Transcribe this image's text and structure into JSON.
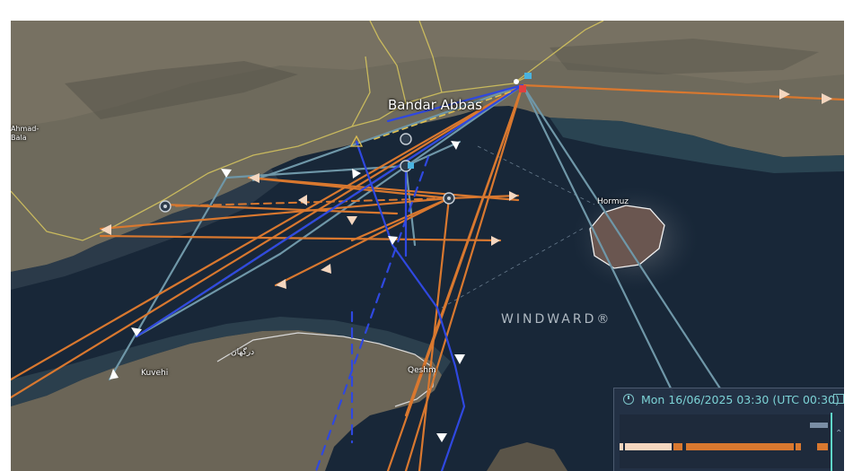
{
  "map": {
    "places": {
      "bandar_abbas": "Bandar Abbas",
      "hormuz": "Hormuz",
      "ahmad_bala_1": "Ahmad-",
      "ahmad_bala_2": "Bala",
      "kuvehi": "Kuvehi",
      "qeshm": "Qeshm",
      "dargahan": "درگهان"
    },
    "watermark": "WINDWARD®",
    "track_colors": {
      "orange": "#d9782f",
      "blue": "#2f48e0",
      "grey_blue": "#6f97a8"
    }
  },
  "timeline": {
    "datetime": "Mon 16/06/2025 03:30 (UTC 00:30)",
    "clock_icon": "clock-icon",
    "calendar_icon": "calendar-icon",
    "scroll_icon": "chevron-up-icon",
    "bar_colors": {
      "light": "#f4d6bf",
      "orange": "#d9782f",
      "dark": "#1e2a3b"
    }
  }
}
